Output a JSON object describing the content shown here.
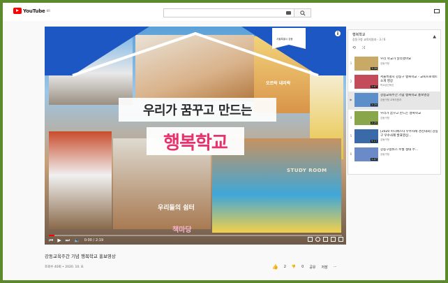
{
  "masthead": {
    "logo_text": "YouTube",
    "logo_region": "KR",
    "search_placeholder": ""
  },
  "player": {
    "overlay_line1": "우리가 꿈꾸고 만드는",
    "overlay_line2": "행복학교",
    "tag_room": "오르락 내리락",
    "tag_study": "STUDY ROOM",
    "tag_shelter": "우리들의 쉼터",
    "tag_yard": "책마당",
    "flag_text": "서울특별시 강동",
    "current_time": "0:00 / 2:19",
    "progress": 0.02
  },
  "video": {
    "title": "강동교육주간 기념 행복학교 홍보영상",
    "meta": "조회수 40회 • 2020. 10. 8.",
    "likes": "2",
    "dislikes": "0",
    "share": "공유",
    "save": "저장",
    "more": "⋯"
  },
  "playlist": {
    "title": "행복학교",
    "subtitle": "강동구청 교육지원과 - 3 / 6",
    "items": [
      {
        "index": "1",
        "name": "우리 학교가 달라졌어요",
        "channel": "강동구청",
        "duration": "3:26",
        "color": "#c8aa66"
      },
      {
        "index": "2",
        "name": "서울특별시 강동구 행복학교 - 교육프로젝트 소개 영상",
        "channel": "학교공간혁신",
        "duration": "2:47",
        "color": "#c44b5a"
      },
      {
        "index": "▶",
        "name": "강동교육주간 기념 행복학교 홍보영상",
        "channel": "강동구청 교육지원과",
        "duration": "2:20",
        "color": "#5c8fc9",
        "active": true
      },
      {
        "index": "4",
        "name": "우리가 꿈꾸고 만드는 행복학교",
        "channel": "강동구청",
        "duration": "2:25",
        "color": "#8aa64a"
      },
      {
        "index": "5",
        "name": "[2020 미니페스타 우수사례 경진대회] 강동구 우수사례 발표영상...",
        "channel": "강동구청",
        "duration": "9:13",
        "color": "#3a6aa8"
      },
      {
        "index": "6",
        "name": "강동구청뉴스 수월 생태 주...",
        "channel": "강동구청",
        "duration": "2:47",
        "color": "#6a8ac8"
      }
    ]
  }
}
